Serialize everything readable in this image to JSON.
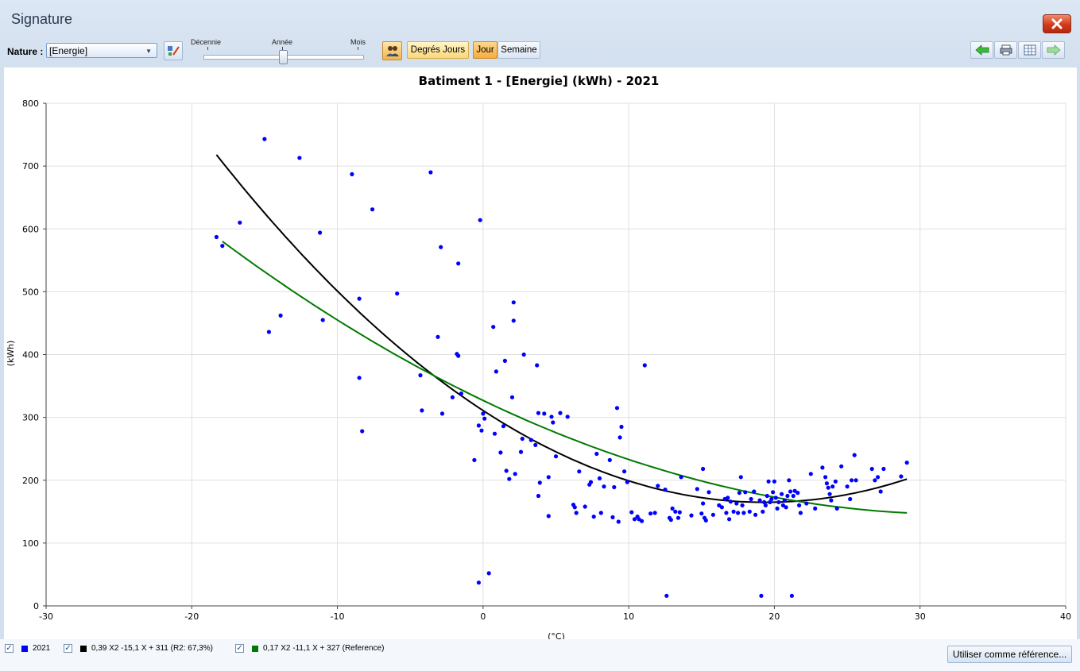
{
  "window": {
    "title": "Signature"
  },
  "toolbar": {
    "nature_label": "Nature :",
    "nature_value": "[Energie]",
    "slider_labels": [
      "Décennie",
      "Année",
      "Mois"
    ],
    "btn_degres_jours": "Degrés Jours",
    "btn_jour": "Jour",
    "btn_semaine": "Semaine"
  },
  "legend": {
    "items": [
      {
        "label": "2021",
        "color": "#0000ff",
        "checked": true
      },
      {
        "label": "0,39 X2 -15,1 X + 311 (R2: 67,3%)",
        "color": "#000000",
        "checked": true
      },
      {
        "label": "0,17 X2 -11,1 X + 327 (Reference)",
        "color": "#007a00",
        "checked": true
      }
    ],
    "ref_button": "Utiliser comme référence..."
  },
  "chart_data": {
    "type": "scatter",
    "title": "Batiment 1 - [Energie] (kWh) - 2021",
    "xlabel": "(°C)",
    "ylabel": "(kWh)",
    "xlim": [
      -30,
      40
    ],
    "ylim": [
      0,
      800
    ],
    "xticks": [
      -30,
      -20,
      -10,
      0,
      10,
      20,
      30,
      40
    ],
    "yticks": [
      0,
      100,
      200,
      300,
      400,
      500,
      600,
      700,
      800
    ],
    "grid": true,
    "legend_position": "bottom",
    "series": [
      {
        "name": "2021",
        "kind": "scatter",
        "color": "#0000ff",
        "points": [
          [
            -18.3,
            587
          ],
          [
            -17.9,
            573
          ],
          [
            -16.7,
            610
          ],
          [
            -15,
            743
          ],
          [
            -14.7,
            436
          ],
          [
            -13.9,
            462
          ],
          [
            -12.6,
            713
          ],
          [
            -11.2,
            594
          ],
          [
            -11,
            455
          ],
          [
            -9,
            687
          ],
          [
            -8.5,
            489
          ],
          [
            -8.5,
            363
          ],
          [
            -8.3,
            278
          ],
          [
            -7.6,
            631
          ],
          [
            -5.9,
            497
          ],
          [
            -4.3,
            367
          ],
          [
            -4.2,
            311
          ],
          [
            -3.6,
            690
          ],
          [
            -3.1,
            428
          ],
          [
            -2.9,
            571
          ],
          [
            -2.8,
            306
          ],
          [
            -2.1,
            332
          ],
          [
            -1.8,
            401
          ],
          [
            -1.7,
            545
          ],
          [
            -1.7,
            398
          ],
          [
            -1.5,
            338
          ],
          [
            -0.6,
            232
          ],
          [
            -0.3,
            287
          ],
          [
            -0.3,
            37
          ],
          [
            -0.2,
            614
          ],
          [
            -0.1,
            279
          ],
          [
            0,
            306
          ],
          [
            0.1,
            298
          ],
          [
            0.4,
            52
          ],
          [
            0.7,
            444
          ],
          [
            0.8,
            274
          ],
          [
            0.9,
            373
          ],
          [
            1.2,
            244
          ],
          [
            1.4,
            286
          ],
          [
            1.5,
            390
          ],
          [
            1.6,
            215
          ],
          [
            1.8,
            202
          ],
          [
            2,
            332
          ],
          [
            2.1,
            483
          ],
          [
            2.1,
            454
          ],
          [
            2.2,
            210
          ],
          [
            2.6,
            245
          ],
          [
            2.7,
            266
          ],
          [
            2.8,
            400
          ],
          [
            3.3,
            264
          ],
          [
            3.6,
            256
          ],
          [
            3.7,
            383
          ],
          [
            3.8,
            307
          ],
          [
            3.9,
            196
          ],
          [
            3.8,
            175
          ],
          [
            4.2,
            306
          ],
          [
            4.5,
            205
          ],
          [
            4.5,
            143
          ],
          [
            4.7,
            301
          ],
          [
            4.8,
            292
          ],
          [
            5,
            238
          ],
          [
            5.3,
            307
          ],
          [
            5.8,
            301
          ],
          [
            6.2,
            161
          ],
          [
            6.3,
            157
          ],
          [
            6.4,
            148
          ],
          [
            6.6,
            214
          ],
          [
            7,
            158
          ],
          [
            7.3,
            193
          ],
          [
            7.4,
            197
          ],
          [
            7.6,
            142
          ],
          [
            7.8,
            242
          ],
          [
            8,
            203
          ],
          [
            8.1,
            148
          ],
          [
            8.3,
            190
          ],
          [
            8.7,
            232
          ],
          [
            8.9,
            141
          ],
          [
            9,
            189
          ],
          [
            9.2,
            315
          ],
          [
            9.3,
            134
          ],
          [
            9.4,
            268
          ],
          [
            9.5,
            285
          ],
          [
            9.7,
            214
          ],
          [
            9.9,
            197
          ],
          [
            10.2,
            149
          ],
          [
            10.4,
            138
          ],
          [
            10.6,
            142
          ],
          [
            10.7,
            138
          ],
          [
            10.9,
            135
          ],
          [
            11.1,
            383
          ],
          [
            11.5,
            147
          ],
          [
            11.8,
            148
          ],
          [
            12,
            191
          ],
          [
            12.5,
            185
          ],
          [
            12.6,
            16
          ],
          [
            12.8,
            140
          ],
          [
            12.9,
            137
          ],
          [
            13,
            155
          ],
          [
            13.2,
            150
          ],
          [
            13.4,
            140
          ],
          [
            13.5,
            149
          ],
          [
            13.6,
            205
          ],
          [
            14.3,
            144
          ],
          [
            14.7,
            186
          ],
          [
            15,
            147
          ],
          [
            15.1,
            218
          ],
          [
            15.1,
            163
          ],
          [
            15.2,
            140
          ],
          [
            15.3,
            136
          ],
          [
            15.5,
            181
          ],
          [
            15.8,
            145
          ],
          [
            16.2,
            160
          ],
          [
            16.4,
            157
          ],
          [
            16.6,
            170
          ],
          [
            16.7,
            148
          ],
          [
            16.8,
            172
          ],
          [
            16.9,
            138
          ],
          [
            17,
            166
          ],
          [
            17.2,
            150
          ],
          [
            17.4,
            163
          ],
          [
            17.5,
            148
          ],
          [
            17.6,
            180
          ],
          [
            17.7,
            205
          ],
          [
            17.8,
            160
          ],
          [
            17.9,
            148
          ],
          [
            18,
            181
          ],
          [
            18.3,
            150
          ],
          [
            18.4,
            170
          ],
          [
            18.6,
            182
          ],
          [
            18.7,
            145
          ],
          [
            19,
            168
          ],
          [
            19.1,
            16
          ],
          [
            19.2,
            150
          ],
          [
            19.3,
            165
          ],
          [
            19.4,
            160
          ],
          [
            19.5,
            175
          ],
          [
            19.6,
            198
          ],
          [
            19.7,
            165
          ],
          [
            19.8,
            170
          ],
          [
            19.9,
            181
          ],
          [
            20,
            198
          ],
          [
            20.1,
            172
          ],
          [
            20.2,
            155
          ],
          [
            20.3,
            165
          ],
          [
            20.5,
            178
          ],
          [
            20.6,
            160
          ],
          [
            20.7,
            168
          ],
          [
            20.8,
            157
          ],
          [
            20.9,
            175
          ],
          [
            21,
            200
          ],
          [
            21.1,
            182
          ],
          [
            21.2,
            16
          ],
          [
            21.3,
            175
          ],
          [
            21.4,
            183
          ],
          [
            21.6,
            180
          ],
          [
            21.7,
            160
          ],
          [
            21.8,
            148
          ],
          [
            22.2,
            163
          ],
          [
            22.5,
            210
          ],
          [
            22.8,
            155
          ],
          [
            23.3,
            220
          ],
          [
            23.5,
            205
          ],
          [
            23.6,
            195
          ],
          [
            23.7,
            188
          ],
          [
            23.8,
            178
          ],
          [
            23.9,
            168
          ],
          [
            24,
            190
          ],
          [
            24.2,
            198
          ],
          [
            24.3,
            155
          ],
          [
            24.6,
            222
          ],
          [
            25,
            190
          ],
          [
            25.2,
            170
          ],
          [
            25.3,
            200
          ],
          [
            25.5,
            240
          ],
          [
            25.6,
            200
          ],
          [
            26.7,
            218
          ],
          [
            26.9,
            200
          ],
          [
            27.1,
            205
          ],
          [
            27.3,
            182
          ],
          [
            27.5,
            218
          ],
          [
            28.7,
            206
          ],
          [
            29.1,
            228
          ]
        ]
      },
      {
        "name": "0,39 X2 -15,1 X + 311 (R2: 67,3%)",
        "kind": "curve",
        "color": "#000000",
        "coefficients": [
          0.39,
          -15.1,
          311
        ],
        "x_range": [
          -18.3,
          29.1
        ]
      },
      {
        "name": "0,17 X2 -11,1 X + 327 (Reference)",
        "kind": "curve",
        "color": "#007a00",
        "coefficients": [
          0.17,
          -11.1,
          327
        ],
        "x_range": [
          -17.9,
          29.1
        ]
      }
    ]
  }
}
